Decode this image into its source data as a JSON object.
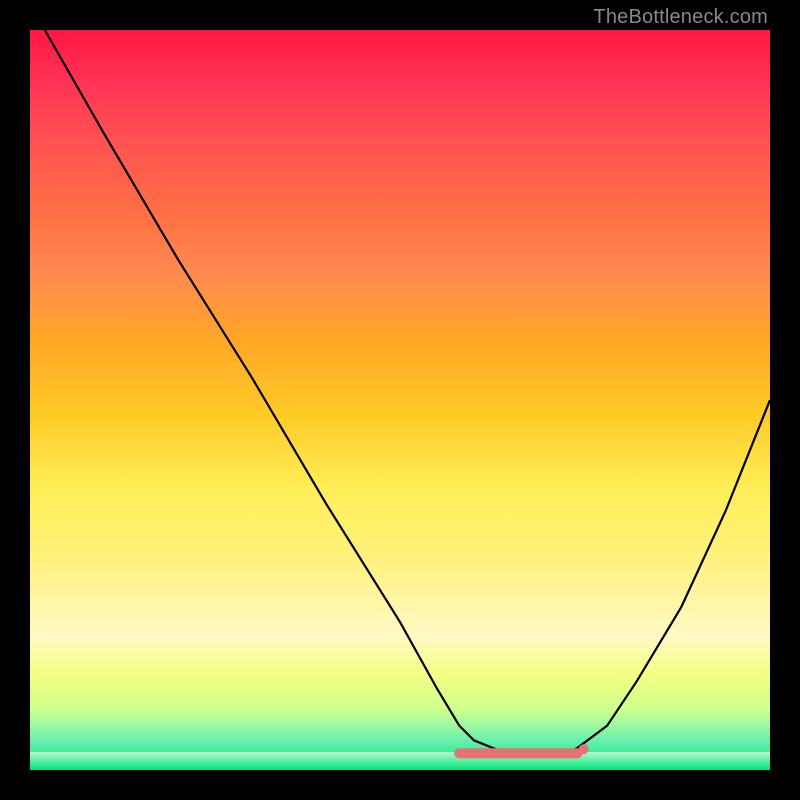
{
  "watermark": "TheBottleneck.com",
  "chart_data": {
    "type": "line",
    "title": "",
    "xlabel": "",
    "ylabel": "",
    "xlim": [
      0,
      100
    ],
    "ylim": [
      0,
      100
    ],
    "series": [
      {
        "name": "bottleneck-curve",
        "x": [
          2,
          10,
          20,
          30,
          40,
          50,
          55,
          58,
          60,
          65,
          70,
          72,
          74,
          78,
          82,
          88,
          94,
          100
        ],
        "values": [
          100,
          86,
          69,
          53,
          36,
          20,
          11,
          6,
          4,
          2,
          2,
          2,
          3,
          6,
          12,
          22,
          35,
          50
        ]
      }
    ],
    "flat_region": {
      "x_start": 58,
      "x_end": 74,
      "y": 2,
      "color": "#e57373"
    },
    "gradient": {
      "top": "#ff1744",
      "mid": "#ffee58",
      "bottom": "#00e676"
    }
  }
}
